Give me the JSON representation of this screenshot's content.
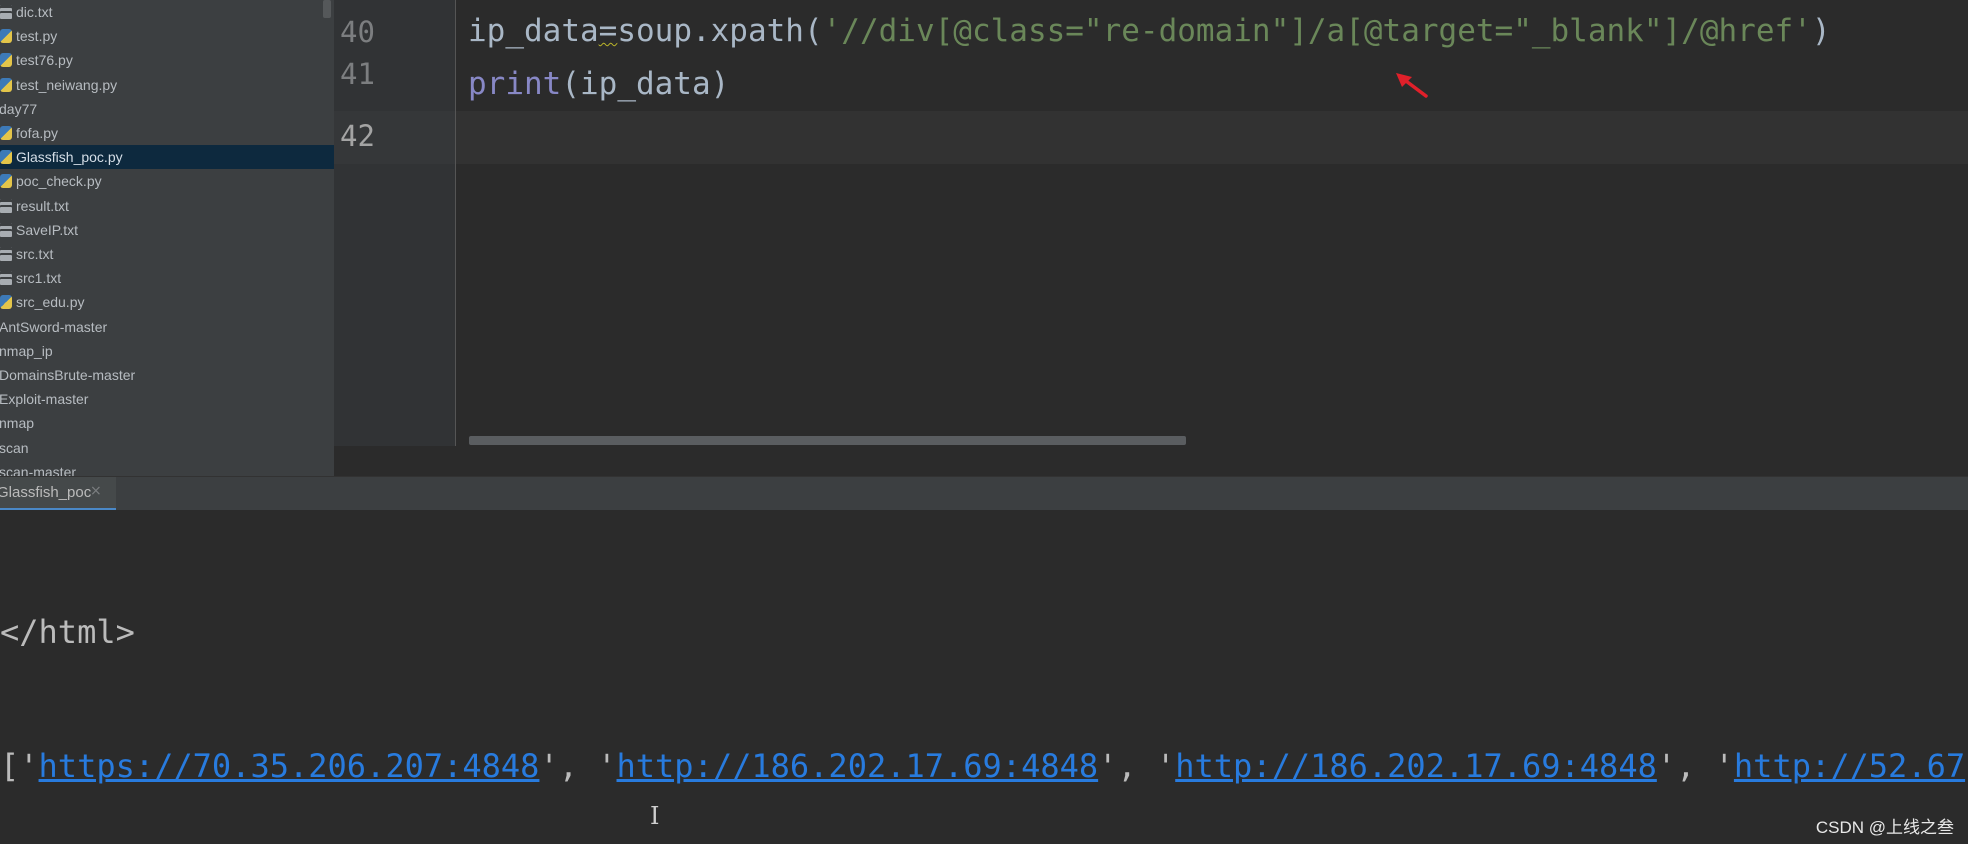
{
  "sidebar": {
    "items": [
      {
        "label": "dic.txt",
        "icon": "txt-icon",
        "indent": 1
      },
      {
        "label": "test.py",
        "icon": "python-file-icon",
        "indent": 1
      },
      {
        "label": "test76.py",
        "icon": "python-file-icon",
        "indent": 1
      },
      {
        "label": "test_neiwang.py",
        "icon": "python-file-icon",
        "indent": 1
      },
      {
        "label": "day77",
        "icon": "",
        "indent": 0
      },
      {
        "label": "fofa.py",
        "icon": "python-file-icon",
        "indent": 1
      },
      {
        "label": "Glassfish_poc.py",
        "icon": "python-file-icon",
        "indent": 1,
        "selected": true
      },
      {
        "label": "poc_check.py",
        "icon": "python-file-icon",
        "indent": 1
      },
      {
        "label": "result.txt",
        "icon": "txt-icon",
        "indent": 1
      },
      {
        "label": "SaveIP.txt",
        "icon": "txt-icon",
        "indent": 1
      },
      {
        "label": "src.txt",
        "icon": "txt-icon",
        "indent": 1
      },
      {
        "label": "src1.txt",
        "icon": "txt-icon",
        "indent": 1
      },
      {
        "label": "src_edu.py",
        "icon": "python-file-icon",
        "indent": 1
      },
      {
        "label": "AntSword-master",
        "icon": "",
        "indent": 0
      },
      {
        "label": "nmap_ip",
        "icon": "",
        "indent": 0
      },
      {
        "label": "DomainsBrute-master",
        "icon": "",
        "indent": 0
      },
      {
        "label": "Exploit-master",
        "icon": "",
        "indent": 0
      },
      {
        "label": "nmap",
        "icon": "",
        "indent": 0
      },
      {
        "label": "scan",
        "icon": "",
        "indent": 0
      },
      {
        "label": "scan-master",
        "icon": "",
        "indent": 0
      }
    ]
  },
  "editor": {
    "line_numbers": [
      "40",
      "41",
      "42"
    ],
    "current_line": "42",
    "line40": {
      "var": "ip_data",
      "op": "=",
      "call": "soup.xpath(",
      "string": "'//div[@class=\"re-domain\"]/a[@target=\"_blank\"]/@href'",
      "close": ")"
    },
    "line41": {
      "builtin": "print",
      "args": "(ip_data)"
    }
  },
  "run": {
    "tab_label": "Glassfish_poc",
    "close_glyph": "×",
    "console_html_line": "</html>",
    "list_open": "['",
    "links": [
      "https://70.35.206.207:4848",
      "http://186.202.17.69:4848",
      "http://186.202.17.69:4848",
      "http://52.67"
    ],
    "separator": "', '"
  },
  "watermark": "CSDN @上线之叁",
  "colors": {
    "string": "#6a8759",
    "builtin": "#8888c6",
    "link": "#287bde",
    "annotation_arrow": "#e0202a"
  }
}
